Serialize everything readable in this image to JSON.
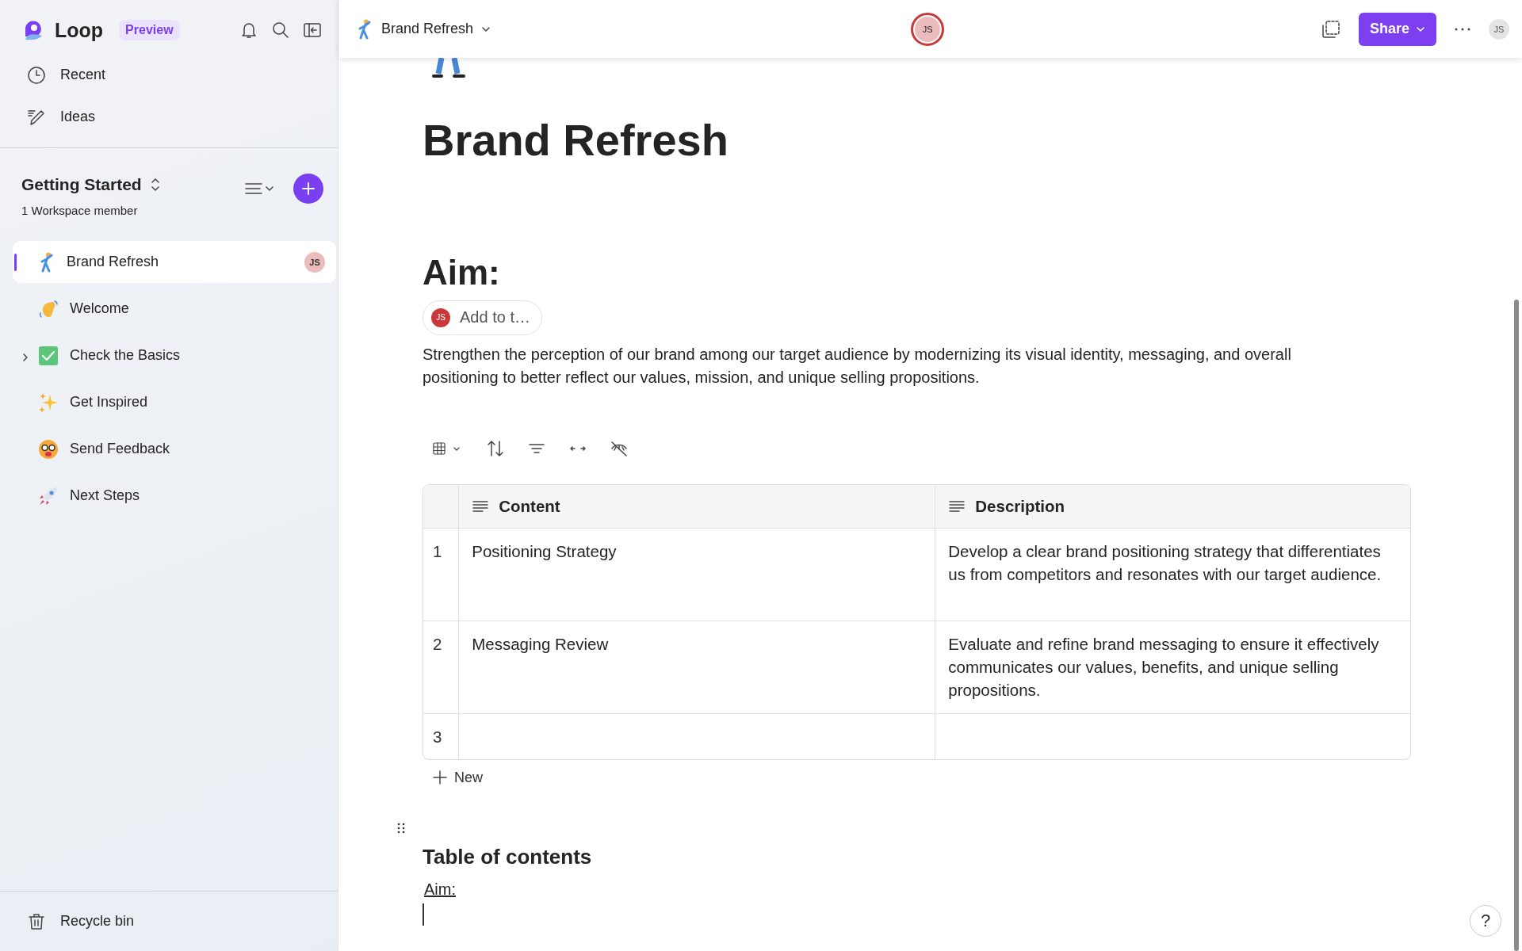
{
  "sidebar": {
    "app_name": "Loop",
    "badge": "Preview",
    "nav": [
      {
        "label": "Recent"
      },
      {
        "label": "Ideas"
      }
    ],
    "workspace": {
      "title": "Getting Started",
      "subtitle": "1 Workspace member"
    },
    "pages": [
      {
        "label": "Brand Refresh",
        "selected": true,
        "avatar": "JS"
      },
      {
        "label": "Welcome",
        "selected": false
      },
      {
        "label": "Check the Basics",
        "selected": false,
        "expanded": false
      },
      {
        "label": "Get Inspired",
        "selected": false
      },
      {
        "label": "Send Feedback",
        "selected": false
      },
      {
        "label": "Next Steps",
        "selected": false
      }
    ],
    "footer": {
      "label": "Recycle bin"
    }
  },
  "topbar": {
    "page_title": "Brand Refresh",
    "collaborator": "JS",
    "share": "Share",
    "user": "JS"
  },
  "document": {
    "title": "Brand Refresh",
    "heading": "Aim:",
    "assign_chip": {
      "avatar": "JS",
      "label": "Add to t…"
    },
    "paragraph": "Strengthen the perception of our brand among our target audience by modernizing its visual identity, messaging, and overall positioning to better reflect our values, mission, and unique selling propositions.",
    "table": {
      "columns": [
        "Content",
        "Description"
      ],
      "rows": [
        {
          "number": "1",
          "cells": [
            "Positioning Strategy",
            "Develop a clear brand positioning strategy that differentiates us from competitors and resonates with our target audience."
          ]
        },
        {
          "number": "2",
          "cells": [
            "Messaging Review",
            "Evaluate and refine brand messaging to ensure it effectively communicates our values, benefits, and unique selling propositions."
          ]
        },
        {
          "number": "3"
        }
      ]
    },
    "new_label": "New",
    "toc": {
      "title": "Table of contents",
      "links": [
        "Aim:"
      ]
    }
  },
  "help": "?"
}
